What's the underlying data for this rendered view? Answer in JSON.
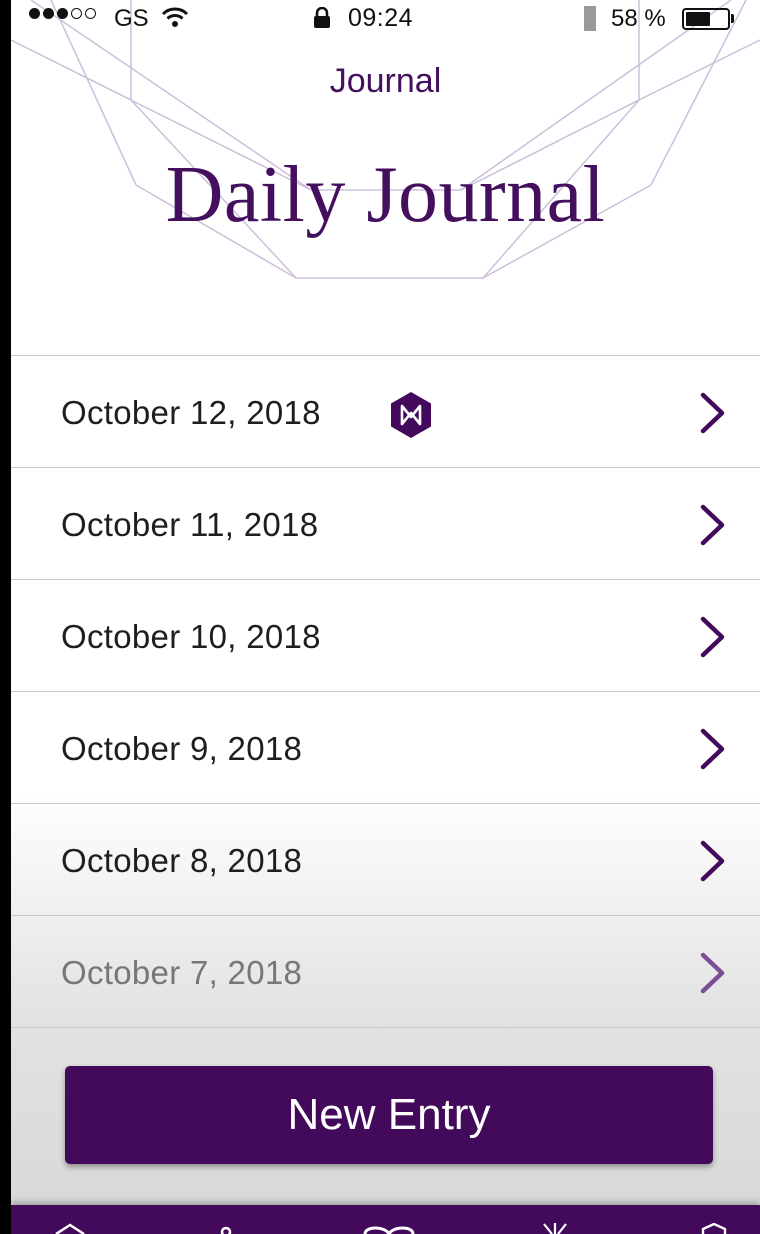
{
  "status_bar": {
    "carrier": "GS",
    "time": "09:24",
    "battery_percent": "58 %",
    "battery_level": 0.58,
    "signal_bars_filled": 3,
    "signal_bars_total": 5
  },
  "nav": {
    "title": "Journal"
  },
  "page": {
    "title": "Daily Journal"
  },
  "entries": [
    {
      "date": "October 12, 2018",
      "badge": "hexagon-badge-icon"
    },
    {
      "date": "October 11, 2018"
    },
    {
      "date": "October 10, 2018"
    },
    {
      "date": "October 9, 2018"
    },
    {
      "date": "October 8, 2018"
    },
    {
      "date": "October 7, 2018"
    }
  ],
  "actions": {
    "new_entry_label": "New Entry"
  },
  "colors": {
    "brand": "#430a5c",
    "text": "#1e1e1e",
    "divider": "#c8c8c8"
  },
  "tabbar": {
    "icons": [
      "home-icon",
      "person-icon",
      "infinity-icon",
      "sparkle-icon",
      "hexagon-icon"
    ]
  }
}
